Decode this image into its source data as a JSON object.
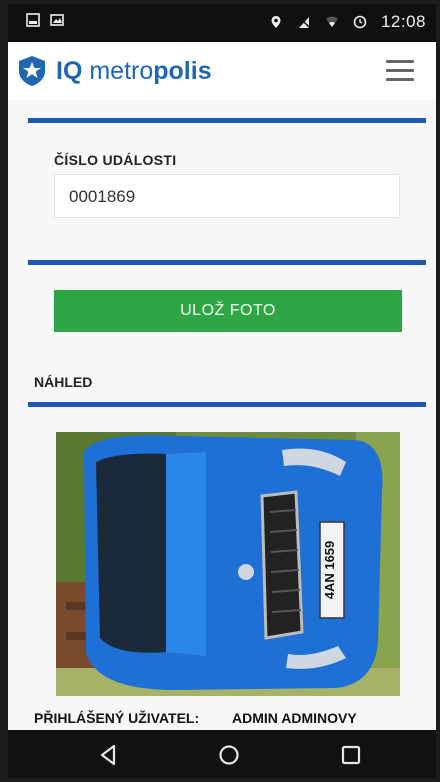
{
  "status_bar": {
    "time": "12:08",
    "icons": [
      "notification-icon",
      "image-icon",
      "location-icon",
      "no-sim-icon",
      "wifi-icon",
      "alarm-icon"
    ]
  },
  "header": {
    "logo_icon": "shield-star-icon",
    "logo_prefix": "IQ",
    "logo_middle": " metro",
    "logo_suffix": "polis",
    "menu_icon": "hamburger-menu-icon"
  },
  "form": {
    "event_number_label": "ČÍSLO UDÁLOSTI",
    "event_number_value": "0001869",
    "save_photo_label": "ULOŽ FOTO",
    "preview_label": "NÁHLED"
  },
  "preview": {
    "plate_text": "4AN 1659"
  },
  "footer": {
    "user_label": "PŘIHLÁŠENÝ UŽIVATEL:",
    "user_value": "ADMIN ADMINOVY"
  },
  "nav_bar": {
    "buttons": [
      "back-icon",
      "home-icon",
      "recents-icon"
    ]
  },
  "colors": {
    "brand_blue": "#1f67b3",
    "divider_blue": "#1d58b3",
    "button_green": "#2ea646"
  }
}
